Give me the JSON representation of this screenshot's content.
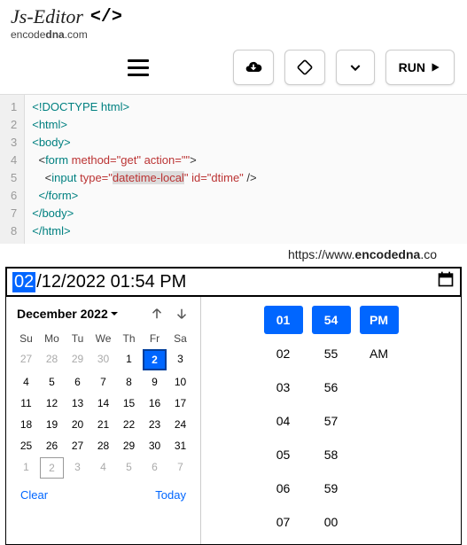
{
  "header": {
    "title": "Js-Editor",
    "subdomain_pre": "encode",
    "subdomain_bold": "dna",
    "subdomain_post": ".com"
  },
  "toolbar": {
    "run_label": "RUN"
  },
  "editor": {
    "lines": [
      "1",
      "2",
      "3",
      "4",
      "5",
      "6",
      "7",
      "8"
    ],
    "code": {
      "l1": "<!DOCTYPE html>",
      "l2": "<html>",
      "l3": "<body>",
      "l4_indent": "  <",
      "l4_tag": "form",
      "l4_a1": " method",
      "l4_v1": "=\"get\"",
      "l4_a2": " action",
      "l4_v2": "=\"\"",
      "l4_end": ">",
      "l5_indent": "    <",
      "l5_tag": "input",
      "l5_a1": " type",
      "l5_eq": "=\"",
      "l5_hl": "datetime-local",
      "l5_q": "\"",
      "l5_a2": " id",
      "l5_v2": "=\"dtime\"",
      "l5_end": " />",
      "l6": "  </form>",
      "l7": "</body>",
      "l8": "</html>"
    }
  },
  "watermark": {
    "pre": "https://www.",
    "bold": "encodedna",
    "post": ".co"
  },
  "dtfield": {
    "sel": "02",
    "rest": "/12/2022 01:54 PM"
  },
  "calendar": {
    "title": "December 2022",
    "dow": [
      "Su",
      "Mo",
      "Tu",
      "We",
      "Th",
      "Fr",
      "Sa"
    ],
    "rows": [
      [
        {
          "d": "27",
          "o": 1
        },
        {
          "d": "28",
          "o": 1
        },
        {
          "d": "29",
          "o": 1
        },
        {
          "d": "30",
          "o": 1
        },
        {
          "d": "1"
        },
        {
          "d": "2",
          "s": 1
        },
        {
          "d": "3"
        }
      ],
      [
        {
          "d": "4"
        },
        {
          "d": "5"
        },
        {
          "d": "6"
        },
        {
          "d": "7"
        },
        {
          "d": "8"
        },
        {
          "d": "9"
        },
        {
          "d": "10"
        }
      ],
      [
        {
          "d": "11"
        },
        {
          "d": "12"
        },
        {
          "d": "13"
        },
        {
          "d": "14"
        },
        {
          "d": "15"
        },
        {
          "d": "16"
        },
        {
          "d": "17"
        }
      ],
      [
        {
          "d": "18"
        },
        {
          "d": "19"
        },
        {
          "d": "20"
        },
        {
          "d": "21"
        },
        {
          "d": "22"
        },
        {
          "d": "23"
        },
        {
          "d": "24"
        }
      ],
      [
        {
          "d": "25"
        },
        {
          "d": "26"
        },
        {
          "d": "27"
        },
        {
          "d": "28"
        },
        {
          "d": "29"
        },
        {
          "d": "30"
        },
        {
          "d": "31"
        }
      ],
      [
        {
          "d": "1",
          "o": 1
        },
        {
          "d": "2",
          "o": 1,
          "t": 1
        },
        {
          "d": "3",
          "o": 1
        },
        {
          "d": "4",
          "o": 1
        },
        {
          "d": "5",
          "o": 1
        },
        {
          "d": "6",
          "o": 1
        },
        {
          "d": "7",
          "o": 1
        }
      ]
    ],
    "clear": "Clear",
    "today": "Today"
  },
  "time": {
    "rows": [
      [
        {
          "v": "01",
          "s": 1
        },
        {
          "v": "54",
          "s": 1
        },
        {
          "v": "PM",
          "s": 1
        }
      ],
      [
        {
          "v": "02"
        },
        {
          "v": "55"
        },
        {
          "v": "AM"
        }
      ],
      [
        {
          "v": "03"
        },
        {
          "v": "56"
        },
        {
          "v": ""
        }
      ],
      [
        {
          "v": "04"
        },
        {
          "v": "57"
        },
        {
          "v": ""
        }
      ],
      [
        {
          "v": "05"
        },
        {
          "v": "58"
        },
        {
          "v": ""
        }
      ],
      [
        {
          "v": "06"
        },
        {
          "v": "59"
        },
        {
          "v": ""
        }
      ],
      [
        {
          "v": "07"
        },
        {
          "v": "00"
        },
        {
          "v": ""
        }
      ]
    ]
  }
}
